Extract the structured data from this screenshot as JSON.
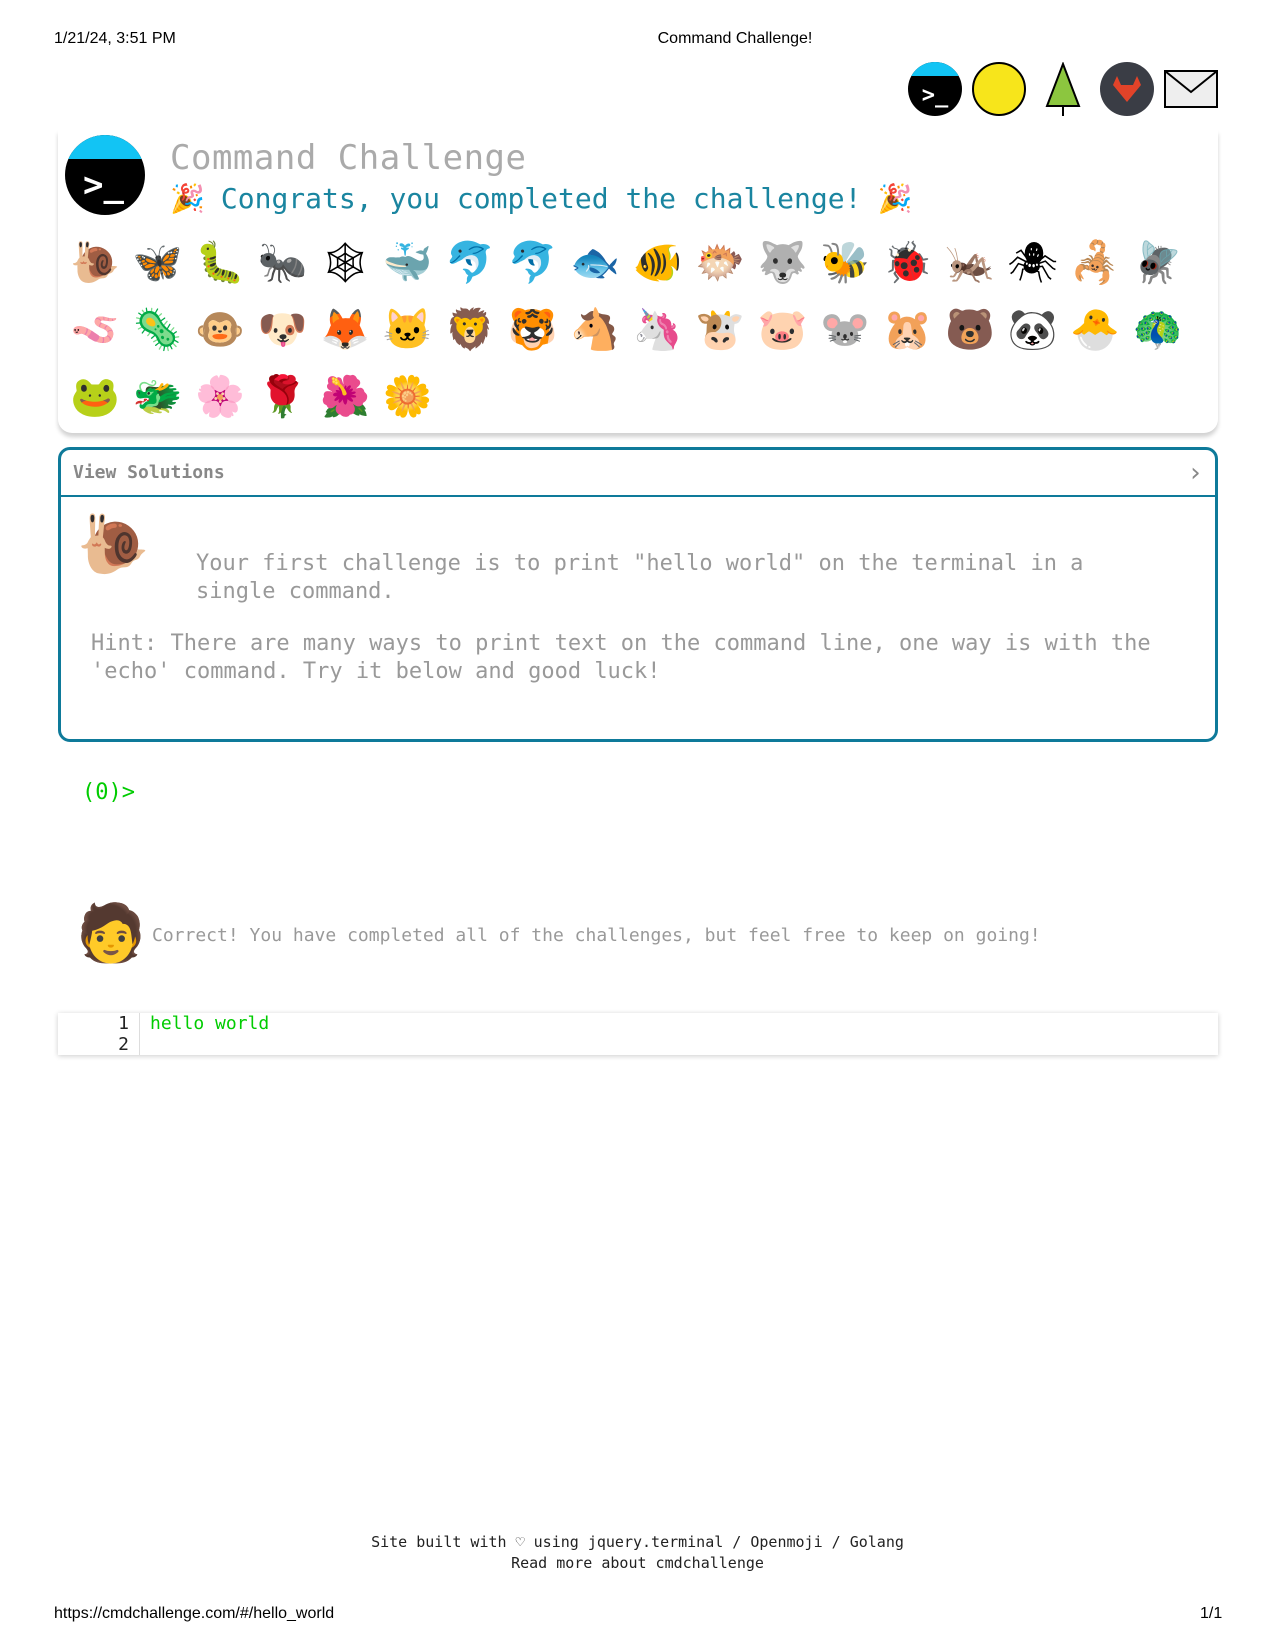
{
  "print_header": {
    "date": "1/21/24, 3:51 PM",
    "title": "Command Challenge!"
  },
  "top_icons": [
    "terminal-icon",
    "face-with-hand-over-mouth-icon",
    "evergreen-tree-icon",
    "gitlab-icon",
    "envelope-icon"
  ],
  "header": {
    "title": "Command Challenge",
    "congrats": "Congrats, you completed the challenge!",
    "party_icon": "🎉"
  },
  "badges": [
    [
      "🐌",
      "🦋",
      "🐛",
      "🐜",
      "🕸",
      "🐳",
      "🐬",
      "🐬",
      "🐟",
      "🐠",
      "🐡",
      "🐺",
      "🐝",
      "🐞",
      "🦗",
      "🕷",
      "🦂",
      "🪰"
    ],
    [
      "🪱",
      "🦠",
      "🐵",
      "🐶",
      "🦊",
      "🐱",
      "🦁",
      "🐯",
      "🐴",
      "🦄",
      "🐮",
      "🐷",
      "🐭",
      "🐹",
      "🐻",
      "🐼",
      "🐣",
      "🦚"
    ],
    [
      "🐸",
      "🐲",
      "🌸",
      "🌹",
      "🌺",
      "🌼"
    ]
  ],
  "solutions": {
    "label": "View Solutions",
    "chevron": "›",
    "icon": "🐌",
    "challenge": "Your first challenge is to print \"hello world\" on the terminal in a single command.",
    "hint": "Hint: There are many ways to print text on the command line, one way is with the 'echo' command. Try it below and good luck!"
  },
  "terminal": {
    "prompt": "(0)>",
    "person_icon": "🧑",
    "message": "Correct! You have completed all of the challenges, but feel free to keep on going!"
  },
  "output": {
    "lines": [
      {
        "n": "1",
        "text": "hello world"
      },
      {
        "n": "2",
        "text": ""
      }
    ]
  },
  "footer": {
    "line1": "Site built with ♡ using jquery.terminal / Openmoji / Golang",
    "line2": "Read more about cmdchallenge"
  },
  "print_footer": {
    "url": "https://cmdchallenge.com/#/hello_world",
    "page": "1/1"
  },
  "colors": {
    "accent": "#0e7a9a",
    "congrats": "#1a85a0",
    "terminal_green": "#00cc00",
    "muted": "#999999"
  }
}
